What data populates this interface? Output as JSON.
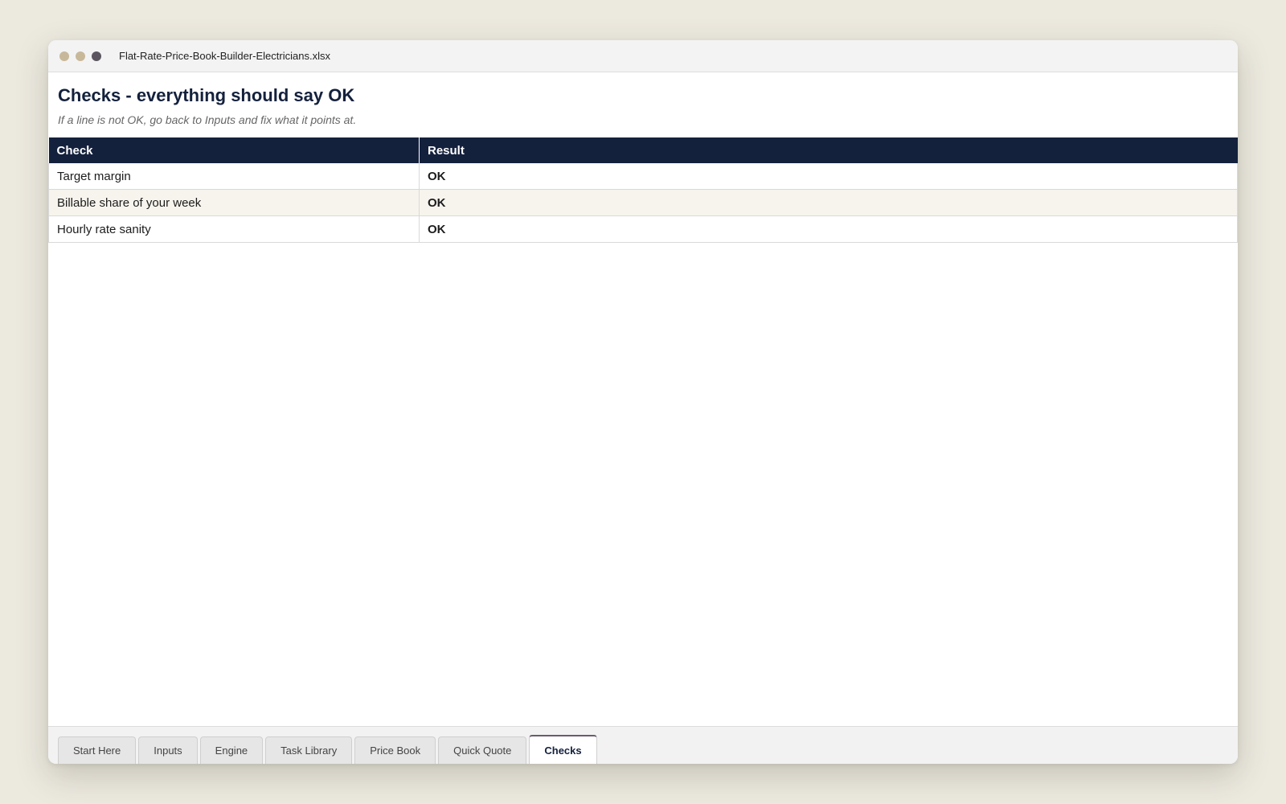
{
  "window": {
    "filename": "Flat-Rate-Price-Book-Builder-Electricians.xlsx",
    "traffic_lights": [
      "#c8b89a",
      "#c8b89a",
      "#5b5560"
    ]
  },
  "sheet": {
    "title": "Checks - everything should say OK",
    "subtitle": "If a line is not OK, go back to Inputs and fix what it points at.",
    "table": {
      "columns": [
        "Check",
        "Result"
      ],
      "rows": [
        {
          "check": "Target margin",
          "result": "OK"
        },
        {
          "check": "Billable share of your week",
          "result": "OK"
        },
        {
          "check": "Hourly rate sanity",
          "result": "OK"
        }
      ]
    }
  },
  "tabs": [
    {
      "label": "Start Here",
      "active": false
    },
    {
      "label": "Inputs",
      "active": false
    },
    {
      "label": "Engine",
      "active": false
    },
    {
      "label": "Task Library",
      "active": false
    },
    {
      "label": "Price Book",
      "active": false
    },
    {
      "label": "Quick Quote",
      "active": false
    },
    {
      "label": "Checks",
      "active": true
    }
  ],
  "colors": {
    "header_navy": "#14213d",
    "alt_row": "#f7f4ed",
    "page_bg": "#ece9df"
  }
}
